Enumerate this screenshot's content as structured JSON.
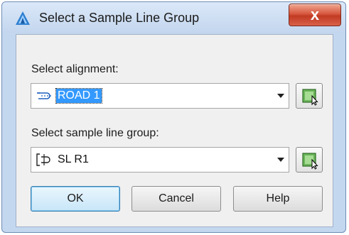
{
  "dialog": {
    "title": "Select a Sample Line Group",
    "close_label": "x",
    "icon": "autodesk-civil3d-icon"
  },
  "alignment": {
    "label": "Select alignment:",
    "value": "ROAD 1",
    "icon": "alignment-icon",
    "pick_icon": "pick-from-drawing-icon"
  },
  "sample_line_group": {
    "label": "Select sample line group:",
    "value": "SL R1",
    "icon": "sample-line-group-icon",
    "pick_icon": "pick-from-drawing-icon"
  },
  "buttons": {
    "ok": "OK",
    "cancel": "Cancel",
    "help": "Help"
  }
}
